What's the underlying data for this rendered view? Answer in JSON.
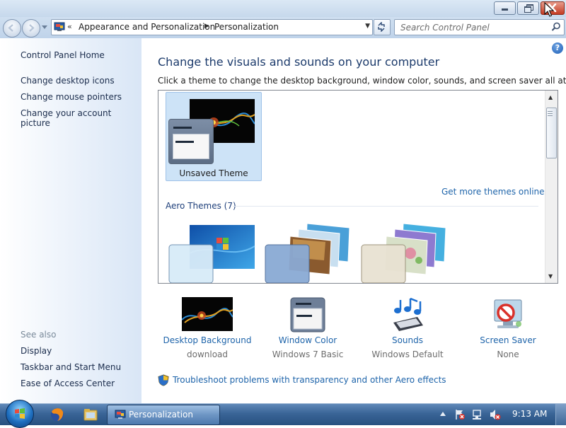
{
  "window": {
    "title": "Personalization"
  },
  "nav": {
    "back_icon": "back-arrow-icon",
    "forward_icon": "forward-arrow-icon",
    "address_overflow": "«",
    "breadcrumbs": [
      "Appearance and Personalization",
      "Personalization"
    ],
    "search_placeholder": "Search Control Panel"
  },
  "sidebar": {
    "home": "Control Panel Home",
    "tasks": [
      "Change desktop icons",
      "Change mouse pointers",
      "Change your account picture"
    ],
    "see_also_label": "See also",
    "see_also": [
      "Display",
      "Taskbar and Start Menu",
      "Ease of Access Center"
    ]
  },
  "main": {
    "heading": "Change the visuals and sounds on your computer",
    "subheading": "Click a theme to change the desktop background, window color, sounds, and screen saver all at once.",
    "my_themes": [
      {
        "label": "Unsaved Theme",
        "selected": true
      }
    ],
    "get_more_link": "Get more themes online",
    "aero_section": "Aero Themes (7)",
    "aero_themes_visible": 3
  },
  "settings": [
    {
      "title": "Desktop Background",
      "subtitle": "download",
      "icon": "wallpaper-thumbnail-icon"
    },
    {
      "title": "Window Color",
      "subtitle": "Windows 7 Basic",
      "icon": "window-color-icon"
    },
    {
      "title": "Sounds",
      "subtitle": "Windows Default",
      "icon": "music-notes-icon"
    },
    {
      "title": "Screen Saver",
      "subtitle": "None",
      "icon": "screen-saver-icon"
    }
  ],
  "troubleshoot_link": "Troubleshoot problems with transparency and other Aero effects",
  "taskbar": {
    "active_window": "Personalization",
    "clock": "9:13 AM"
  },
  "colors": {
    "link": "#1e64aa",
    "heading": "#1b3a6b",
    "selection": "#cde3f7",
    "taskbar": "#3a6597"
  }
}
